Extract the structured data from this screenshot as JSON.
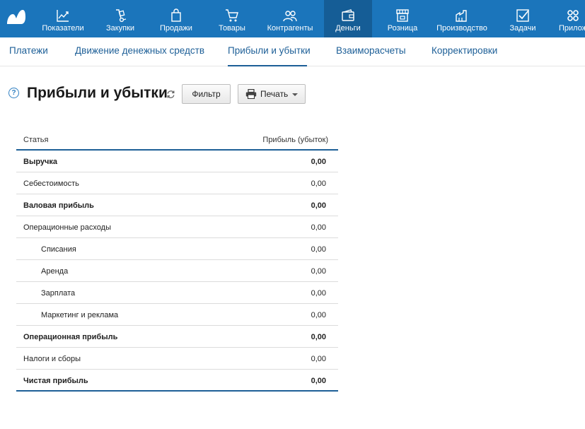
{
  "nav": {
    "items": [
      {
        "label": "Показатели",
        "icon": "chart-line-icon"
      },
      {
        "label": "Закупки",
        "icon": "hand-truck-icon"
      },
      {
        "label": "Продажи",
        "icon": "shopping-bag-icon"
      },
      {
        "label": "Товары",
        "icon": "cart-icon"
      },
      {
        "label": "Контрагенты",
        "icon": "people-icon"
      },
      {
        "label": "Деньги",
        "icon": "wallet-icon",
        "active": true
      },
      {
        "label": "Розница",
        "icon": "storefront-icon"
      },
      {
        "label": "Производство",
        "icon": "factory-icon"
      },
      {
        "label": "Задачи",
        "icon": "checkbox-icon"
      },
      {
        "label": "Прилож",
        "icon": "apps-gear-icon"
      }
    ],
    "bg_color": "#1b75bb",
    "active_color": "#155d96"
  },
  "subnav": {
    "tabs": [
      {
        "label": "Платежи"
      },
      {
        "label": "Движение денежных средств"
      },
      {
        "label": "Прибыли и убытки",
        "active": true
      },
      {
        "label": "Взаиморасчеты"
      },
      {
        "label": "Корректировки"
      }
    ],
    "accent_color": "#1d5f97"
  },
  "page": {
    "help_glyph": "?",
    "title": "Прибыли и убытки",
    "filter_label": "Фильтр",
    "print_label": "Печать"
  },
  "report": {
    "columns": [
      "Статья",
      "Прибыль (убыток)"
    ],
    "rows": [
      {
        "name": "Выручка",
        "value": "0,00",
        "bold": true
      },
      {
        "name": "Себестоимость",
        "value": "0,00"
      },
      {
        "name": "Валовая прибыль",
        "value": "0,00",
        "bold": true
      },
      {
        "name": "Операционные расходы",
        "value": "0,00"
      },
      {
        "name": "Списания",
        "value": "0,00",
        "indent": true
      },
      {
        "name": "Аренда",
        "value": "0,00",
        "indent": true
      },
      {
        "name": "Зарплата",
        "value": "0,00",
        "indent": true
      },
      {
        "name": "Маркетинг и реклама",
        "value": "0,00",
        "indent": true
      },
      {
        "name": "Операционная прибыль",
        "value": "0,00",
        "bold": true
      },
      {
        "name": "Налоги и сборы",
        "value": "0,00"
      },
      {
        "name": "Чистая прибыль",
        "value": "0,00",
        "bold": true
      }
    ]
  }
}
